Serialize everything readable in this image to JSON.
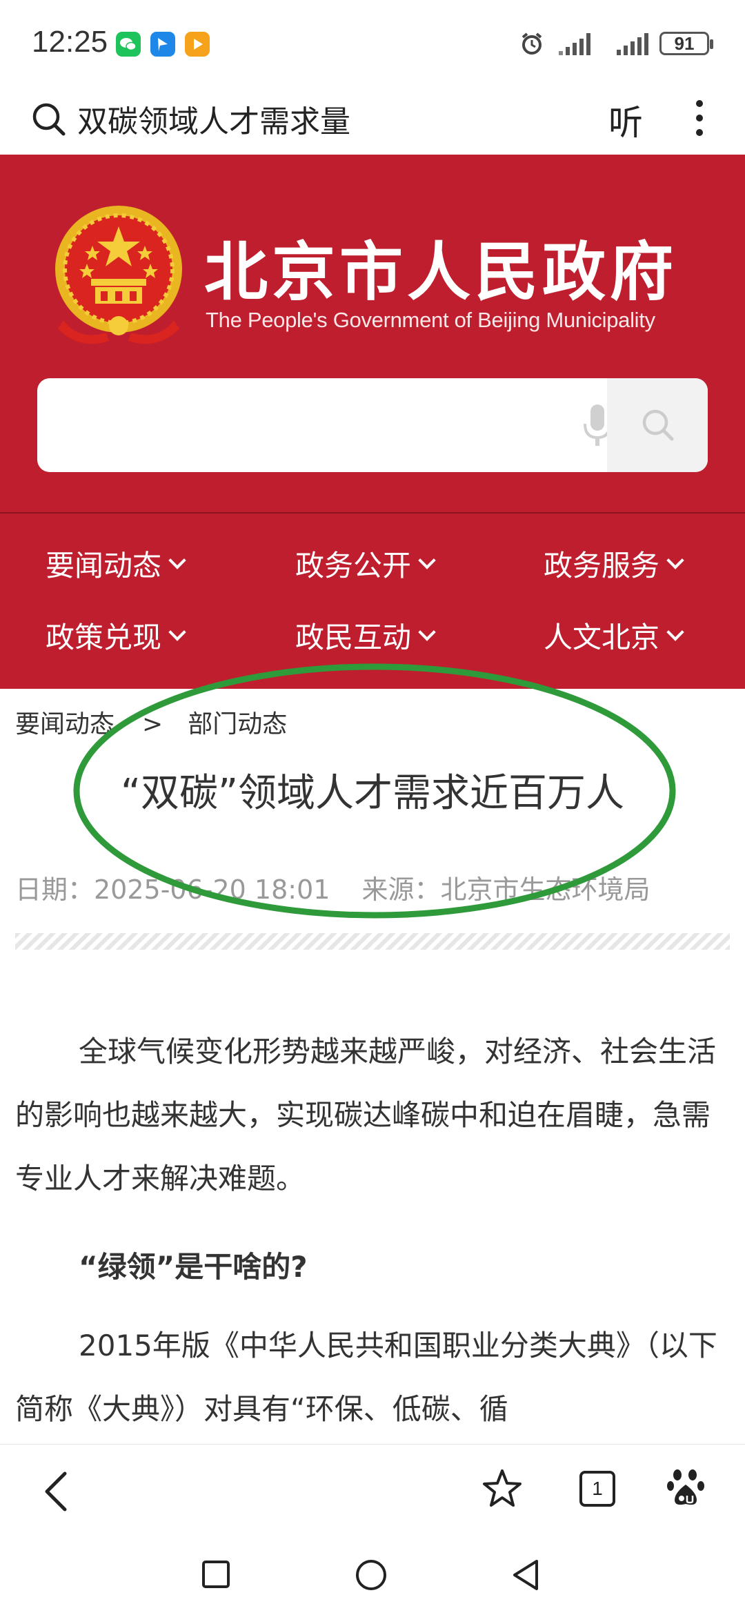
{
  "status_bar": {
    "time": "12:25",
    "battery": "91",
    "app_icons": [
      "wechat-icon",
      "feishu-icon",
      "video-app-icon"
    ],
    "indicators": [
      "alarm-icon",
      "signal-icon",
      "signal-icon"
    ]
  },
  "browser": {
    "query": "双碳领域人才需求量",
    "listen_label": "听"
  },
  "site": {
    "name": "北京市人民政府",
    "subtitle": "The People's Government of Beijing Municipality",
    "search_placeholder": "",
    "brand_color": "#bf1e2e"
  },
  "nav": {
    "items": [
      {
        "label": "要闻动态"
      },
      {
        "label": "政务公开"
      },
      {
        "label": "政务服务"
      },
      {
        "label": "政策兑现"
      },
      {
        "label": "政民互动"
      },
      {
        "label": "人文北京"
      }
    ]
  },
  "article": {
    "breadcrumb": [
      "要闻动态",
      ">",
      "部门动态"
    ],
    "title": "“双碳”领域人才需求近百万人",
    "date": "日期：2025-06-20 18:01",
    "source": "来源：北京市生态环境局",
    "para1": "全球气候变化形势越来越严峻，对经济、社会生活的影响也越来越大，实现碳达峰碳中和迫在眉睫，急需专业人才来解决难题。",
    "subhead": "“绿领”是干啥的?",
    "para2": "2015年版《中华人民共和国职业分类大典》（以下简称《大典》）对具有“环保、低碳、循"
  },
  "bottom_bar": {
    "tab_count": "1"
  },
  "annotation": {
    "color": "#2f9a3a"
  }
}
